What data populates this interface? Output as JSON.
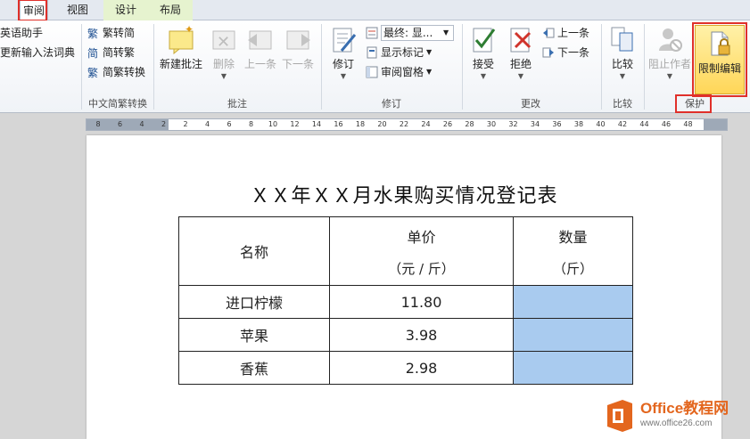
{
  "tabs": {
    "review": "审阅",
    "view": "视图",
    "design": "设计",
    "layout": "布局"
  },
  "proofing": {
    "english_assistant": "英语助手",
    "update_ime_dictionary": "更新输入法词典"
  },
  "chinese_conversion": {
    "to_simplified": "繁转简",
    "to_traditional": "简转繁",
    "conversion": "简繁转换",
    "group_label": "中文简繁转换"
  },
  "comments": {
    "new_comment": "新建批注",
    "delete": "删除",
    "previous": "上一条",
    "next": "下一条",
    "group_label": "批注"
  },
  "tracking": {
    "track_changes": "修订",
    "final_display": "最终: 显...",
    "show_markup": "显示标记",
    "reviewing_pane": "审阅窗格",
    "group_label": "修订"
  },
  "changes": {
    "accept": "接受",
    "reject": "拒绝",
    "previous": "上一条",
    "next": "下一条",
    "group_label": "更改"
  },
  "compare": {
    "compare": "比较",
    "group_label": "比较"
  },
  "protect": {
    "block_authors": "阻止作者",
    "restrict_editing": "限制编辑",
    "group_label": "保护"
  },
  "ruler": {
    "ticks": [
      "8",
      "6",
      "4",
      "2",
      "2",
      "4",
      "6",
      "8",
      "10",
      "12",
      "14",
      "16",
      "18",
      "20",
      "22",
      "24",
      "26",
      "28",
      "30",
      "32",
      "34",
      "36",
      "38",
      "40",
      "42",
      "44",
      "46",
      "48"
    ]
  },
  "document": {
    "title": "ＸＸ年ＸＸ月水果购买情况登记表",
    "table": {
      "headers": {
        "name": "名称",
        "price": "单价",
        "price_unit": "（元 / 斤）",
        "qty": "数量",
        "qty_unit": "（斤）"
      },
      "rows": [
        {
          "name": "进口柠檬",
          "price": "11.80"
        },
        {
          "name": "苹果",
          "price": "3.98"
        },
        {
          "name": "香蕉",
          "price": "2.98"
        }
      ]
    }
  },
  "watermark": {
    "brand": "Office教程网",
    "url": "www.office26.com"
  },
  "colors": {
    "highlight_box": "#e0302a",
    "qty_fill": "#a9cbef",
    "restrict_button": "#ffd658",
    "brand": "#e3661e"
  }
}
